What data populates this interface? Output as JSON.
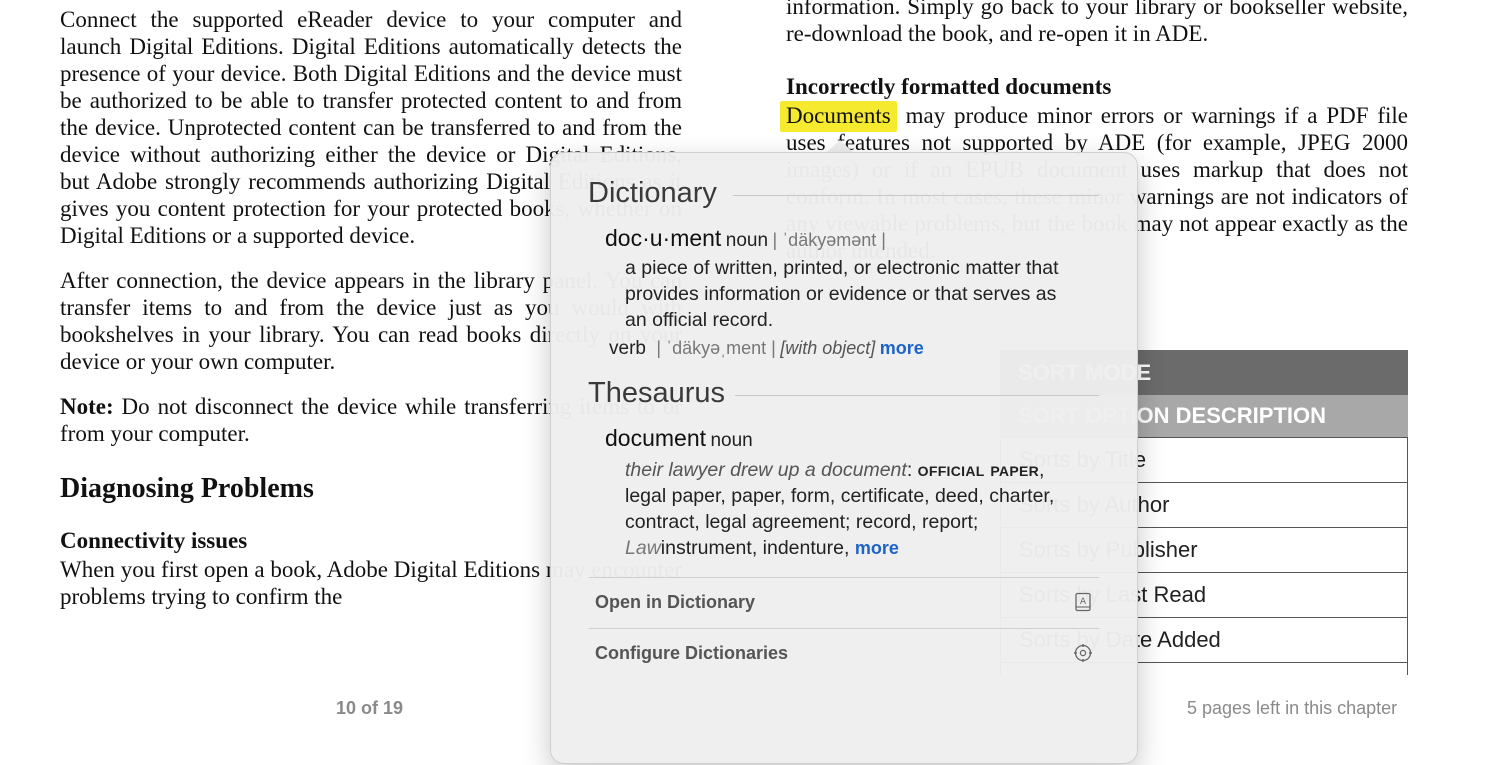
{
  "left": {
    "p1": "Connect the supported eReader device to your computer and launch Digital Editions. Digital Editions automatically detects the presence of your device. Both Digital Editions and the device must be authorized to be able to transfer protected content to and from the device. Unprotected content can be transferred to and from the device without authorizing either the device or Digital Editions, but Adobe strongly recommends authorizing Digital Editions as it gives you content protection for your protected books, whether on Digital Editions or a supported device.",
    "p2": "After connection, the device appears in the library panel. You can transfer items to and from the device just as you would with bookshelves in your library. You can read books directly on your device or your own computer.",
    "note_label": "Note:",
    "note_text": " Do not disconnect the device while transferring items to or from your computer.",
    "heading": "Diagnosing Problems",
    "subheading": "Connectivity issues",
    "p3": "When you first open a book, Adobe Digital Editions may encounter problems trying to confirm the"
  },
  "right": {
    "p1": "information. Simply go back to your library or bookseller website, re-download the book, and re-open it in ADE.",
    "subheading": "Incorrectly formatted documents",
    "highlight": "Documents",
    "p2_rest": " may produce minor errors or warnings if a PDF file uses features not supported by ADE (for example, JPEG 2000 images) or if an EPUB document uses markup that does not conform. In most cases, these minor warnings are not indicators of any viewable problems, but the book may not appear exactly as the author intended."
  },
  "table": {
    "header1": "SORT MODE",
    "header2": "SORT OPTION DESCRIPTION",
    "rows": [
      "Sorts by Title",
      "Sorts by Author",
      "Sorts by Publisher",
      "Sorts by Last Read",
      "Sorts by Date Added"
    ]
  },
  "footer": {
    "page_count": "10 of 19",
    "pages_left": "5 pages left in this chapter"
  },
  "popover": {
    "dictionary_title": "Dictionary",
    "headword": "doc·u·ment",
    "headword_pos": "noun",
    "headword_pron": "| ˈdäkyəmənt |",
    "definition": "a piece of written, printed, or electronic matter that provides information or evidence or that serves as an official record.",
    "verb_pos": "verb",
    "verb_pron": "| ˈdäkyəˌment |",
    "verb_note": "[with object]",
    "more1": "more",
    "thesaurus_title": "Thesaurus",
    "thes_word": "document",
    "thes_pos": "noun",
    "example": "their lawyer drew up a document",
    "colon": ": ",
    "syn_lead": "official paper",
    "synonyms": ", legal paper, paper, form, certificate, deed, charter, contract, legal agreement; record, report; ",
    "law_label": "Law",
    "synonyms2": "instrument, indenture, ",
    "more2": "more",
    "open_dictionary": "Open in Dictionary",
    "configure": "Configure Dictionaries",
    "colors": {
      "link": "#1d63c8",
      "highlight": "#f6ea2f"
    }
  },
  "icons": {
    "open": "dictionary-book-icon",
    "configure": "gear-icon"
  }
}
